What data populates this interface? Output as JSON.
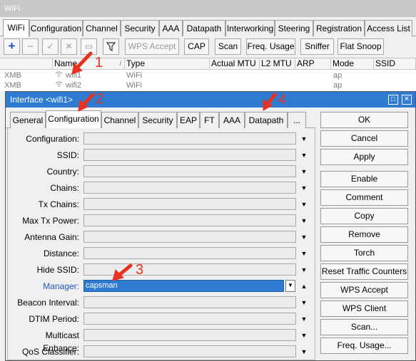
{
  "window": {
    "title": "WiFi"
  },
  "tabs": [
    "WiFi",
    "Configuration",
    "Channel",
    "Security",
    "AAA",
    "Datapath",
    "Interworking",
    "Steering",
    "Registration",
    "Access List"
  ],
  "toolbar": {
    "wps_accept": "WPS Accept",
    "cap": "CAP",
    "scan": "Scan",
    "freq_usage": "Freq. Usage",
    "sniffer": "Sniffer",
    "flat_snoop": "Flat Snoop"
  },
  "grid": {
    "headers": [
      "Name",
      "Type",
      "Actual MTU",
      "L2 MTU",
      "ARP",
      "Mode",
      "SSID"
    ],
    "rows": [
      {
        "flag": "XMB",
        "name": "wifi1",
        "type": "WiFi",
        "mode": "ap"
      },
      {
        "flag": "XMB",
        "name": "wifi2",
        "type": "WiFi",
        "mode": "ap"
      }
    ]
  },
  "dialog": {
    "title": "Interface <wifi1>",
    "min_glyph": "□",
    "close_glyph": "✕",
    "tabs": [
      "General",
      "Configuration",
      "Channel",
      "Security",
      "EAP",
      "FT",
      "AAA",
      "Datapath",
      "..."
    ],
    "fields": [
      {
        "label": "Configuration:",
        "value": ""
      },
      {
        "label": "SSID:",
        "value": ""
      },
      {
        "label": "Country:",
        "value": ""
      },
      {
        "label": "Chains:",
        "value": ""
      },
      {
        "label": "Tx Chains:",
        "value": ""
      },
      {
        "label": "Max Tx Power:",
        "value": ""
      },
      {
        "label": "Antenna Gain:",
        "value": ""
      },
      {
        "label": "Distance:",
        "value": ""
      },
      {
        "label": "Hide SSID:",
        "value": ""
      },
      {
        "label": "Manager:",
        "value": "capsman"
      },
      {
        "label": "Beacon Interval:",
        "value": ""
      },
      {
        "label": "DTIM Period:",
        "value": ""
      },
      {
        "label": "Multicast Enhance:",
        "value": ""
      },
      {
        "label": "QoS Classifier:",
        "value": ""
      }
    ],
    "buttons": [
      "OK",
      "Cancel",
      "Apply",
      "Enable",
      "Comment",
      "Copy",
      "Remove",
      "Torch",
      "Reset Traffic Counters",
      "WPS Accept",
      "WPS Client",
      "Scan...",
      "Freq. Usage..."
    ]
  },
  "annotations": [
    "1",
    "2",
    "3",
    "4"
  ],
  "colors": {
    "accent": "#2f7bd1",
    "annotation": "#e8321f",
    "manager_label": "#2255bb"
  }
}
